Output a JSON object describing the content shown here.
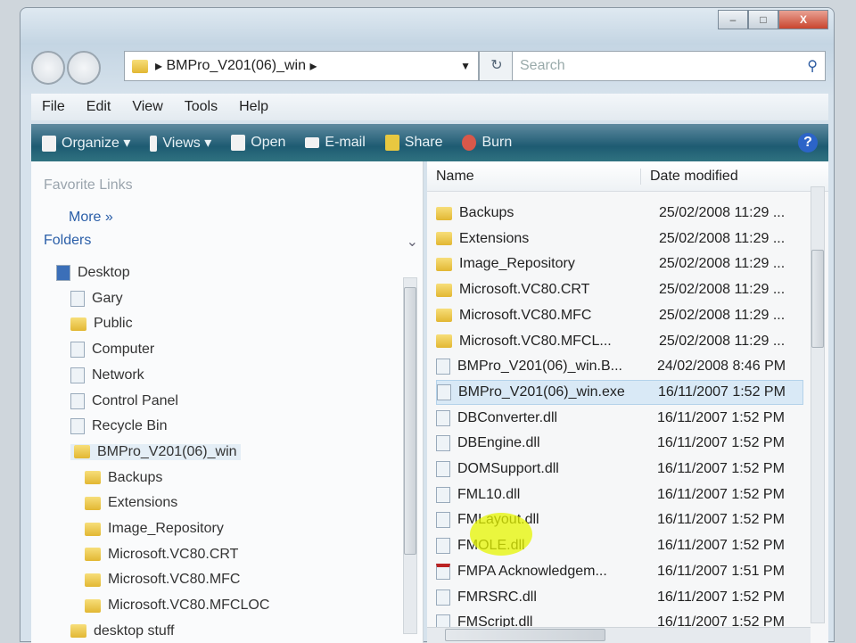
{
  "address": {
    "path": "BMPro_V201(06)_win"
  },
  "search": {
    "placeholder": "Search"
  },
  "caption": {
    "minimize": "–",
    "maximize": "□",
    "close": "X"
  },
  "menu": [
    "File",
    "Edit",
    "View",
    "Tools",
    "Help"
  ],
  "toolbar": {
    "organize": "Organize ▾",
    "views": "Views ▾",
    "open": "Open",
    "email": "E-mail",
    "share": "Share",
    "burn": "Burn",
    "help": "?"
  },
  "left": {
    "favorite_links": "Favorite Links",
    "more": "More »",
    "folders": "Folders",
    "tree": [
      {
        "label": "Desktop",
        "level": 0
      },
      {
        "label": "Gary",
        "level": 1
      },
      {
        "label": "Public",
        "level": 1
      },
      {
        "label": "Computer",
        "level": 1
      },
      {
        "label": "Network",
        "level": 1
      },
      {
        "label": "Control Panel",
        "level": 1
      },
      {
        "label": "Recycle Bin",
        "level": 1
      },
      {
        "label": "BMPro_V201(06)_win",
        "level": 1,
        "selected": true
      },
      {
        "label": "Backups",
        "level": 2
      },
      {
        "label": "Extensions",
        "level": 2
      },
      {
        "label": "Image_Repository",
        "level": 2
      },
      {
        "label": "Microsoft.VC80.CRT",
        "level": 2
      },
      {
        "label": "Microsoft.VC80.MFC",
        "level": 2
      },
      {
        "label": "Microsoft.VC80.MFCLOC",
        "level": 2
      },
      {
        "label": "desktop stuff",
        "level": 1
      }
    ]
  },
  "list": {
    "columns": [
      "Name",
      "Date modified"
    ],
    "rows": [
      {
        "name": "Backups",
        "date": "25/02/2008 11:29 ...",
        "type": "folder"
      },
      {
        "name": "Extensions",
        "date": "25/02/2008 11:29 ...",
        "type": "folder"
      },
      {
        "name": "Image_Repository",
        "date": "25/02/2008 11:29 ...",
        "type": "folder"
      },
      {
        "name": "Microsoft.VC80.CRT",
        "date": "25/02/2008 11:29 ...",
        "type": "folder"
      },
      {
        "name": "Microsoft.VC80.MFC",
        "date": "25/02/2008 11:29 ...",
        "type": "folder"
      },
      {
        "name": "Microsoft.VC80.MFCL...",
        "date": "25/02/2008 11:29 ...",
        "type": "folder"
      },
      {
        "name": "BMPro_V201(06)_win.B...",
        "date": "24/02/2008 8:46 PM",
        "type": "file"
      },
      {
        "name": "BMPro_V201(06)_win.exe",
        "date": "16/11/2007 1:52 PM",
        "type": "exe",
        "selected": true
      },
      {
        "name": "DBConverter.dll",
        "date": "16/11/2007 1:52 PM",
        "type": "dll"
      },
      {
        "name": "DBEngine.dll",
        "date": "16/11/2007 1:52 PM",
        "type": "dll"
      },
      {
        "name": "DOMSupport.dll",
        "date": "16/11/2007 1:52 PM",
        "type": "dll"
      },
      {
        "name": "FML10.dll",
        "date": "16/11/2007 1:52 PM",
        "type": "dll"
      },
      {
        "name": "FMLayout.dll",
        "date": "16/11/2007 1:52 PM",
        "type": "dll"
      },
      {
        "name": "FMOLE.dll",
        "date": "16/11/2007 1:52 PM",
        "type": "dll"
      },
      {
        "name": "FMPA Acknowledgem...",
        "date": "16/11/2007 1:51 PM",
        "type": "pdf"
      },
      {
        "name": "FMRSRC.dll",
        "date": "16/11/2007 1:52 PM",
        "type": "dll"
      },
      {
        "name": "FMScript.dll",
        "date": "16/11/2007 1:52 PM",
        "type": "dll"
      }
    ]
  }
}
